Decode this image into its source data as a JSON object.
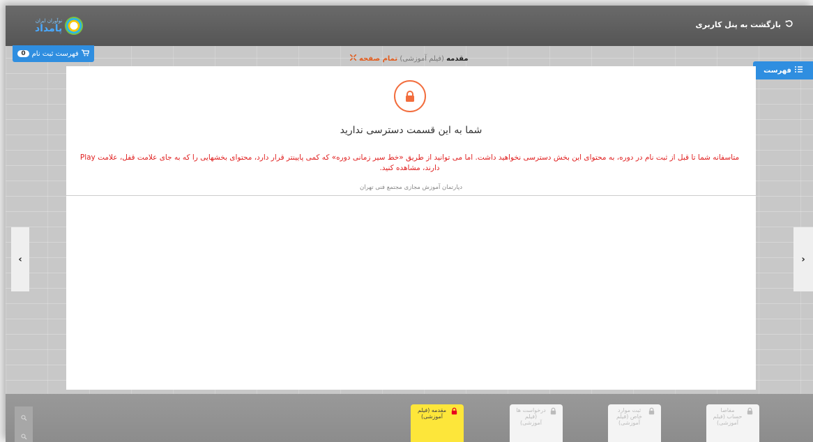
{
  "topbar": {
    "logo_small": "نوآوران ايران",
    "logo_big": "پامداد",
    "back_label": "بازگشت به پنل کاربری"
  },
  "cart": {
    "label": "فهرست ثبت نام",
    "count": "0"
  },
  "lesson": {
    "title": "مقدمه",
    "type": "(فیلم آموزشی)",
    "fullpage": "تمام صفحه"
  },
  "list_button": "فهرست",
  "notice": {
    "heading": "شما به این قسمت دسترسی ندارید",
    "message": "متاسفانه شما تا قبل از ثبت نام در دوره، به محتوای این بخش دسترسی نخواهید داشت. اما می توانید از طریق «خط سیر زمانی دوره» که کمی پایینتر قرار دارد، محتوای بخشهایی را که به جای علامت قفل، علامت Play دارند، مشاهده کنید.",
    "department": "دپارتمان آموزش مجازی مجتمع فنی تهران"
  },
  "nav": {
    "prev": "‹",
    "next": "›"
  },
  "timeline": [
    {
      "label": "مقدمه (فیلم آموزشی)",
      "active": true
    },
    {
      "label": "درخواست ها (فیلم آموزشی)",
      "active": false
    },
    {
      "label": "ثبت موارد خاص (فیلم آموزشی)",
      "active": false
    },
    {
      "label": "مفاصا حساب (فیلم آموزشی)",
      "active": false
    }
  ],
  "colors": {
    "accent": "#2f8ee0",
    "lock": "#f26d3d",
    "warning": "#e02020",
    "active_card": "#fde63a"
  }
}
